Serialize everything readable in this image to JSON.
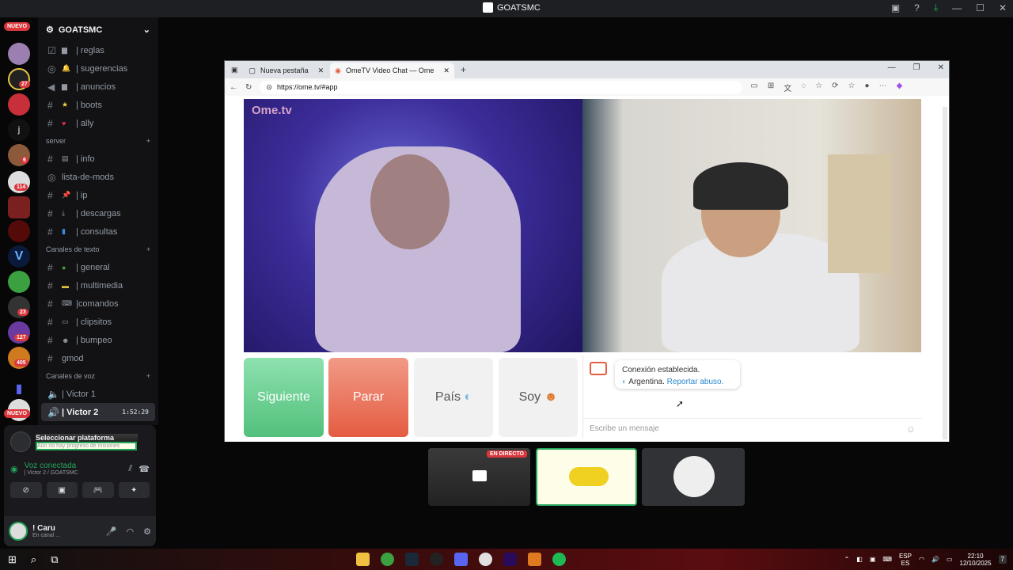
{
  "window": {
    "title": "GOATSMC"
  },
  "rail": {
    "badges": [
      "27",
      "6",
      "114",
      "23",
      "127",
      "405"
    ],
    "nuevo_top": "NUEVO",
    "nuevo_bottom": "NUEVO",
    "dm_letter": "j"
  },
  "server": {
    "name": "GOATSMC",
    "channels_top": [
      {
        "label": "| reglas"
      },
      {
        "label": "| sugerencias"
      },
      {
        "label": "| anuncios"
      },
      {
        "label": "| boots"
      },
      {
        "label": "| ally"
      }
    ],
    "cat_server": "server",
    "channels_server": [
      {
        "label": "| info"
      },
      {
        "label": "lista-de-mods"
      },
      {
        "label": "| ip"
      },
      {
        "label": "| descargas"
      },
      {
        "label": "| consultas"
      }
    ],
    "cat_text": "Canales de texto",
    "channels_text": [
      {
        "label": "| general"
      },
      {
        "label": "| multimedia"
      },
      {
        "label": "|comandos"
      },
      {
        "label": "| clipsitos"
      },
      {
        "label": "| bumpeo"
      },
      {
        "label": "gmod"
      }
    ],
    "cat_voice": "Canales de voz",
    "voice_channels": [
      {
        "label": "| Victor 1"
      },
      {
        "label": "| Victor 2",
        "time": "1:52:29"
      }
    ]
  },
  "panel": {
    "platform_title": "Seleccionar plataforma",
    "platform_sub": "Aún no hay progreso de misiones",
    "voice_status": "Voz conectada",
    "voice_channel": "| Victor 2 / GOATSMC",
    "user_name": "! Caru",
    "user_status": "En canal ..."
  },
  "browser": {
    "tab1": "Nueva pestaña",
    "tab2": "OmeTV Video Chat — Ome",
    "url": "https://ome.tv/#app"
  },
  "ometv": {
    "logo": "Ome.tv",
    "btn_next": "Siguiente",
    "btn_stop": "Parar",
    "btn_country": "País",
    "btn_gender": "Soy",
    "msg_line1": "Conexión establecida.",
    "msg_country": "Argentina.",
    "msg_report": "Reportar abuso.",
    "input_placeholder": "Escribe un mensaje"
  },
  "streams": {
    "live_label": "EN DIRECTO"
  },
  "taskbar": {
    "lang1": "ESP",
    "lang2": "ES",
    "time": "22:10",
    "date": "12/10/2025",
    "notif": "7"
  }
}
